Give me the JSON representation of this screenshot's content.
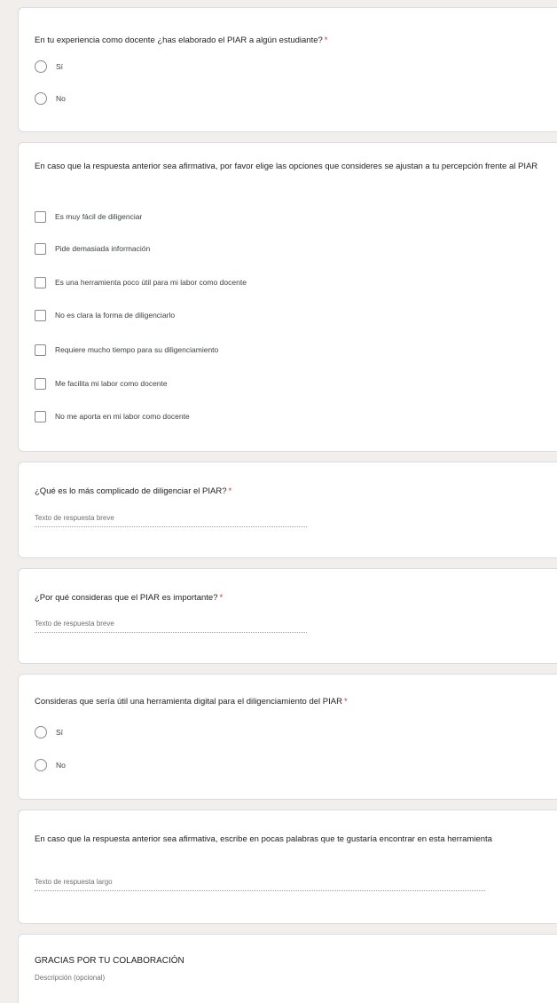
{
  "q1": {
    "title": "En tu experiencia como docente ¿has elaborado el PIAR a algún estudiante?",
    "required": "*",
    "options": [
      "Sí",
      "No"
    ]
  },
  "q2": {
    "title": "En caso que la respuesta anterior sea afirmativa,  por favor elige las opciones que consideres se ajustan a tu percepción frente al PIAR",
    "options": [
      "Es muy fácil de diligenciar",
      "Pide demasiada información",
      "Es una herramienta poco útil para mi labor como docente",
      "No es clara la forma de diligenciarlo",
      "Requiere mucho tiempo para su diligenciamiento",
      "Me facilita mi labor como docente",
      "No me aporta en mi labor como docente"
    ]
  },
  "q3": {
    "title": "¿Qué es lo más complicado de diligenciar el PIAR?",
    "required": "*",
    "answer_placeholder": "Texto de respuesta breve"
  },
  "q4": {
    "title": "¿Por qué consideras que el PIAR es importante?",
    "required": "*",
    "answer_placeholder": "Texto de respuesta breve"
  },
  "q5": {
    "title": "Consideras que sería útil una herramienta digital para el diligenciamiento del PIAR",
    "required": "*",
    "options": [
      "Sí",
      "No"
    ]
  },
  "q6": {
    "title": "En caso que la respuesta anterior sea afirmativa, escribe en pocas palabras que te gustaría encontrar en esta herramienta",
    "answer_placeholder": "Texto de respuesta largo"
  },
  "section": {
    "title": "GRACIAS POR TU COLABORACIÓN",
    "description": "Descripción (opcional)"
  },
  "colors": {
    "background": "#f1eeec",
    "card": "#ffffff",
    "required": "#d93025"
  },
  "icons": [
    "radio-button-icon",
    "checkbox-icon"
  ]
}
